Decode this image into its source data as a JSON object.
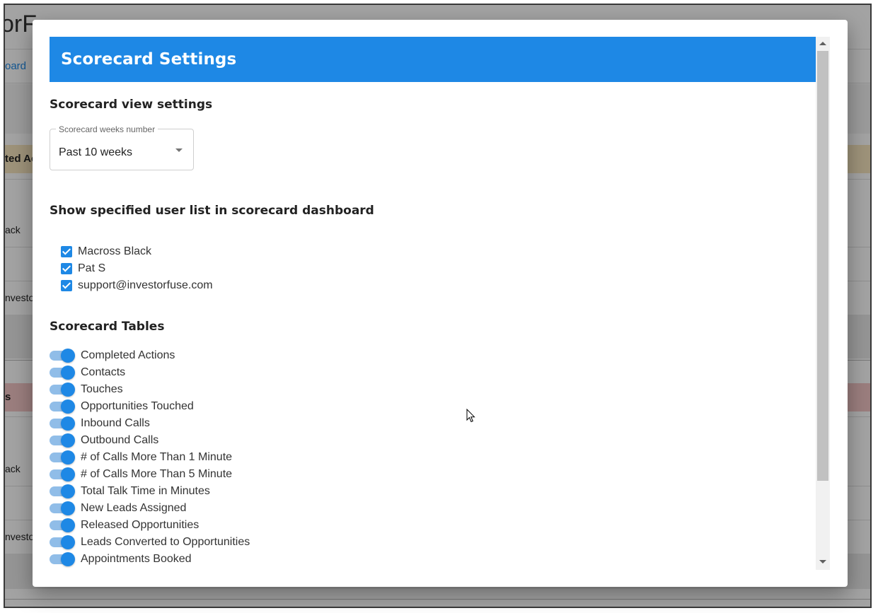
{
  "background": {
    "title_fragment": "orF",
    "link_fragment": "oard",
    "band1_fragment": "ted Ac",
    "band2_fragment": "s",
    "rows": [
      "ack",
      "nvestor",
      "ack",
      "nvestor"
    ]
  },
  "dialog": {
    "title": "Scorecard Settings",
    "view_settings": {
      "heading": "Scorecard view settings",
      "weeks_select": {
        "label": "Scorecard weeks number",
        "value": "Past 10 weeks",
        "caret_icon": "caret-down-icon"
      }
    },
    "user_list": {
      "heading": "Show specified user list in scorecard dashboard",
      "users": [
        {
          "label": "Macross Black",
          "checked": true
        },
        {
          "label": "Pat S",
          "checked": true
        },
        {
          "label": "support@investorfuse.com",
          "checked": true
        }
      ]
    },
    "tables": {
      "heading": "Scorecard Tables",
      "items": [
        {
          "label": "Completed Actions",
          "enabled": true
        },
        {
          "label": "Contacts",
          "enabled": true
        },
        {
          "label": "Touches",
          "enabled": true
        },
        {
          "label": "Opportunities Touched",
          "enabled": true
        },
        {
          "label": "Inbound Calls",
          "enabled": true
        },
        {
          "label": "Outbound Calls",
          "enabled": true
        },
        {
          "label": "# of Calls More Than 1 Minute",
          "enabled": true
        },
        {
          "label": "# of Calls More Than 5 Minute",
          "enabled": true
        },
        {
          "label": "Total Talk Time in Minutes",
          "enabled": true
        },
        {
          "label": "New Leads Assigned",
          "enabled": true
        },
        {
          "label": "Released Opportunities",
          "enabled": true
        },
        {
          "label": "Leads Converted to Opportunities",
          "enabled": true
        },
        {
          "label": "Appointments Booked",
          "enabled": true
        }
      ]
    }
  },
  "colors": {
    "accent": "#1e88e5",
    "toggle_track": "#90bde8",
    "band1": "#f7e7bf",
    "band2": "#f3c5c5"
  }
}
